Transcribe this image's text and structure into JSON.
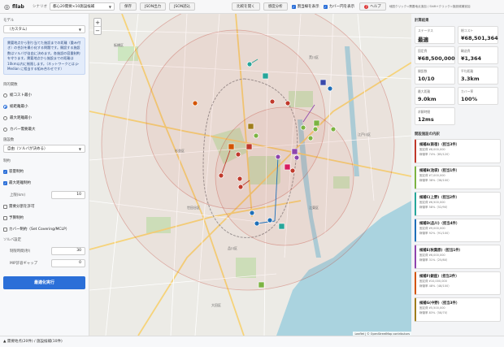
{
  "app": {
    "name": "fllab"
  },
  "topbar": {
    "scenario_label": "シナリオ",
    "scenario_value": "都心20需要×10施設候補",
    "save_label": "保存",
    "json_export_label": "JSON出力",
    "json_import_label": "JSON読込",
    "compare_label": "比較を開く",
    "sensitivity_label": "感度分析",
    "show_assignment_label": "割当線を表示",
    "show_coverage_label": "カバー円を表示",
    "help_label": "ヘルプ",
    "hint": "地図クリック=需要地点追加 / Shift+クリック=施設候補追加"
  },
  "sidebar": {
    "model_label": "モデル",
    "model_value": "（カスタム）",
    "model_info": "需要地点から割り当てた施設までの距離（重み付き）の合計を最小化する問題です。開設する施設数はソルバが自由に決めます。各施設の容量制約を守ります。需要地点から施設までの距離は10km以内に制限します。（ネットワークとは p-Median に相当する組み合わせです）",
    "objective_label": "目的関数",
    "objectives": [
      {
        "label": "総コスト最小",
        "selected": false
      },
      {
        "label": "総距離最小",
        "selected": true
      },
      {
        "label": "最大距離最小",
        "selected": false
      },
      {
        "label": "カバー需要最大",
        "selected": false
      }
    ],
    "facility_count_label": "施設数",
    "facility_count_value": "自由（ソルバが決める）",
    "constraints_label": "制約",
    "constraints": {
      "capacity": {
        "label": "容量制約",
        "checked": true
      },
      "max_distance": {
        "label": "最大距離制約",
        "checked": true
      },
      "max_distance_limit_label": "上限(km)",
      "max_distance_limit_value": "10",
      "split_assignment": {
        "label": "需要分割を許可",
        "checked": false
      },
      "budget": {
        "label": "予算制約",
        "checked": false
      },
      "cover": {
        "label": "カバー制約（Set Covering/MCLP）",
        "checked": false
      }
    },
    "solver_label": "ソルバ設定",
    "time_limit_label": "制限時間(秒)",
    "time_limit_value": "30",
    "mip_gap_label": "MIP許容ギャップ",
    "mip_gap_value": "0",
    "run_label": "最適化実行"
  },
  "results": {
    "title": "計算結果",
    "stats": [
      {
        "key": "ステータス",
        "value": "最適"
      },
      {
        "key": "総コスト",
        "value": "¥68,501,364"
      },
      {
        "key": "固定費",
        "value": "¥68,500,000"
      },
      {
        "key": "輸送費",
        "value": "¥1,364"
      },
      {
        "key": "開設数",
        "value": "10/10"
      },
      {
        "key": "平均距離",
        "value": "3.3km"
      },
      {
        "key": "最大距離",
        "value": "9.0km"
      },
      {
        "key": "カバー率",
        "value": "100%"
      },
      {
        "key": "求解時間",
        "value": "12ms"
      }
    ],
    "candidates_title": "開設施設の内訳",
    "candidates": [
      {
        "name": "候補A(新宿)（担当3件）",
        "fixed": "固定費 ¥8,000,000",
        "util": "稼働率 74%（85/120）",
        "color": "#c0392b"
      },
      {
        "name": "候補B(池袋)（担当1件）",
        "fixed": "固定費 ¥7,000,000",
        "util": "稼働率 38%（38/100）",
        "color": "#7cb342"
      },
      {
        "name": "候補C(上野)（担当2件）",
        "fixed": "固定費 ¥6,500,000",
        "util": "稼働率 58%（52/90）",
        "color": "#26a69a"
      },
      {
        "name": "候補D(品川)（担当4件）",
        "fixed": "固定費 ¥9,000,000",
        "util": "稼働率 92%（91/100）",
        "color": "#1e6fb8"
      },
      {
        "name": "候補E(秋葉原)（担当1件）",
        "fixed": "固定費 ¥6,000,000",
        "util": "稼働率 31%（25/80）",
        "color": "#8e44ad"
      },
      {
        "name": "候補F(銀座)（担当2件）",
        "fixed": "固定費 ¥10,000,000",
        "util": "稼働率 48%（48/100）",
        "color": "#d35400"
      },
      {
        "name": "候補G(中野)（担当3件）",
        "fixed": "固定費 ¥5,500,000",
        "util": "稼働率 83%（58/70）",
        "color": "#a07d1c"
      }
    ]
  },
  "bottom": {
    "status": "▲ 需要地点(20件) / 施設候補(10件)"
  },
  "map": {
    "zoom_in": "+",
    "zoom_out": "−",
    "attribution": "Leaflet | © OpenStreetMap contributors"
  }
}
